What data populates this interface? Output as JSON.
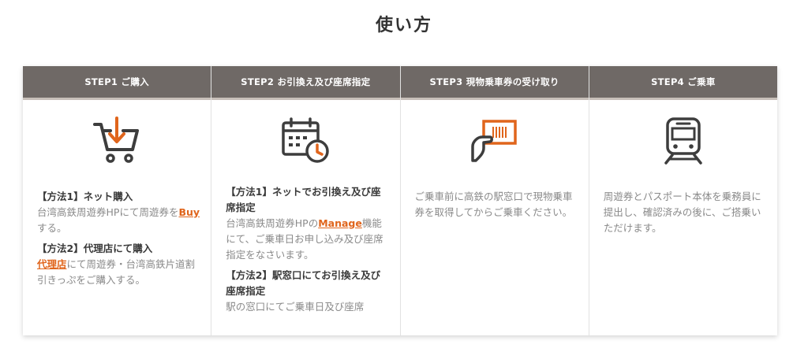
{
  "page": {
    "title": "使い方"
  },
  "colors": {
    "header_bg": "#6f6966",
    "icon_stroke": "#3d3d3d",
    "accent": "#e0651c",
    "header_rule": "#c7bfb9"
  },
  "steps": [
    {
      "header": "STEP1 ご購入",
      "icon": "cart-download-icon",
      "m1_title": "【方法1】ネット購入",
      "m1_text_a": "台湾高鉄周遊券HPにて周遊券を",
      "m1_link": "Buy",
      "m1_text_b": " する。",
      "m2_title": "【方法2】代理店にて購入",
      "m2_link": "代理店",
      "m2_text": "にて周遊券・台湾高鉄片道割引きっぷをご購入する。"
    },
    {
      "header": "STEP2 お引換え及び座席指定",
      "icon": "calendar-clock-icon",
      "m1_title": "【方法1】ネットでお引換え及び座席指定",
      "m1_text_a": "台湾高鉄周遊券HPの",
      "m1_link": "Manage",
      "m1_text_b": "機能にて、ご乗車日お申し込み及び座席指定をなさいます。",
      "m2_title": "【方法2】駅窓口にてお引換え及び座席指定",
      "m2_text": "駅の窓口にてご乗車日及び座席"
    },
    {
      "header": "STEP3 現物乗車券の受け取り",
      "icon": "ticket-hand-icon",
      "text": "ご乗車前に高鉄の駅窓口で現物乗車券を取得してからご乗車ください。"
    },
    {
      "header": "STEP4 ご乗車",
      "icon": "train-icon",
      "text": "周遊券とパスポート本体を乗務員に提出し、確認済みの後に、ご搭乗いただけます。"
    }
  ]
}
